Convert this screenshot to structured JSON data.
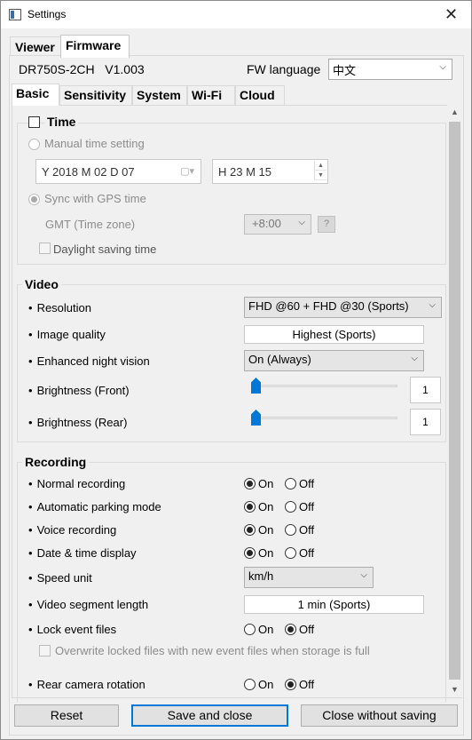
{
  "window": {
    "title": "Settings"
  },
  "outer_tabs": [
    "Viewer",
    "Firmware"
  ],
  "model": {
    "name": "DR750S-2CH",
    "version": "V1.003"
  },
  "fw_language": {
    "label": "FW language",
    "value": "中文"
  },
  "inner_tabs": [
    "Basic",
    "Sensitivity",
    "System",
    "Wi-Fi",
    "Cloud"
  ],
  "time": {
    "title": "Time",
    "manual_label": "Manual time setting",
    "date_value": "Y 2018 M 02 D 07",
    "time_value": "H 23 M 15",
    "gps_label": "Sync with GPS time",
    "gmt_label": "GMT (Time zone)",
    "gmt_value": "+8:00",
    "help": "?",
    "dst_label": "Daylight saving time"
  },
  "video": {
    "title": "Video",
    "resolution_label": "Resolution",
    "resolution_value": "FHD @60 + FHD @30 (Sports)",
    "quality_label": "Image quality",
    "quality_value": "Highest (Sports)",
    "night_label": "Enhanced night vision",
    "night_value": "On (Always)",
    "bright_front_label": "Brightness (Front)",
    "bright_front_value": "1",
    "bright_rear_label": "Brightness (Rear)",
    "bright_rear_value": "1"
  },
  "recording": {
    "title": "Recording",
    "on": "On",
    "off": "Off",
    "normal_label": "Normal recording",
    "parking_label": "Automatic parking mode",
    "voice_label": "Voice recording",
    "datetime_label": "Date & time display",
    "speed_label": "Speed unit",
    "speed_value": "km/h",
    "segment_label": "Video segment length",
    "segment_value": "1 min (Sports)",
    "lock_label": "Lock event files",
    "overwrite_label": "Overwrite locked files with new event files when storage is full",
    "rear_rot_label": "Rear camera rotation"
  },
  "buttons": {
    "reset": "Reset",
    "save": "Save and close",
    "close": "Close without saving"
  },
  "colors": {
    "accent": "#0078d7"
  }
}
